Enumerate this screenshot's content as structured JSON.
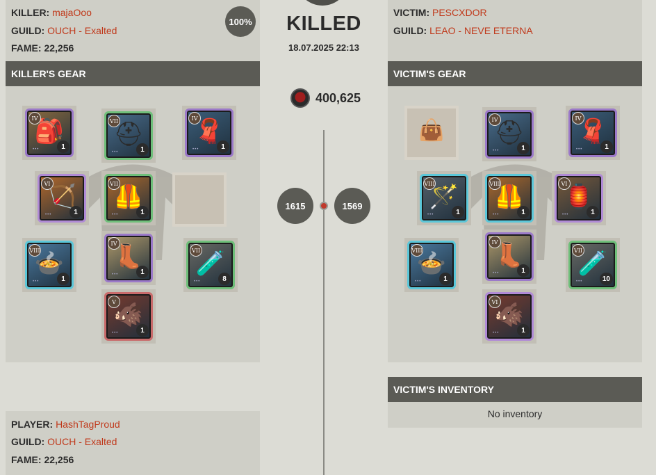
{
  "killer": {
    "killer_label": "KILLER:",
    "name": "majaOoo",
    "guild_label": "GUILD:",
    "guild": "OUCH - Exalted",
    "fame_label": "FAME:",
    "fame": "22,256",
    "damage_pct": "100%"
  },
  "event": {
    "title": "KILLED",
    "datetime": "18.07.2025 22:13",
    "total_fame": "400,625",
    "killer_ip": "1615",
    "victim_ip": "1569"
  },
  "victim": {
    "victim_label": "VICTIM:",
    "name": "PESCXDOR",
    "guild_label": "GUILD:",
    "guild": "LEAO - NEVE ETERNA"
  },
  "headers": {
    "killer_gear": "KILLER'S GEAR",
    "victim_gear": "VICTIM'S GEAR",
    "victim_inventory": "VICTIM'S INVENTORY",
    "no_inventory": "No inventory"
  },
  "assist": {
    "player_label": "PLAYER:",
    "name": "HashTagProud",
    "guild_label": "GUILD:",
    "guild": "OUCH - Exalted",
    "fame_label": "FAME:",
    "fame": "22,256"
  },
  "killer_gear": [
    {
      "slot": "bag",
      "tier": "IV",
      "qty": "1",
      "icon": "bag-icon"
    },
    {
      "slot": "head",
      "tier": "VII",
      "qty": "1",
      "icon": "helmet-icon"
    },
    {
      "slot": "cape",
      "tier": "IV",
      "qty": "1",
      "icon": "cape-icon"
    },
    {
      "slot": "mainhand",
      "tier": "VI",
      "qty": "1",
      "icon": "crossbow-icon"
    },
    {
      "slot": "armor",
      "tier": "VII",
      "qty": "1",
      "icon": "armor-icon"
    },
    {
      "slot": "food",
      "tier": "VIII",
      "qty": "1",
      "icon": "stew-icon"
    },
    {
      "slot": "shoes",
      "tier": "IV",
      "qty": "1",
      "icon": "boots-icon"
    },
    {
      "slot": "potion",
      "tier": "VII",
      "qty": "8",
      "icon": "potion-icon"
    },
    {
      "slot": "mount",
      "tier": "V",
      "qty": "1",
      "icon": "mount-icon"
    }
  ],
  "victim_gear": [
    {
      "slot": "head",
      "tier": "IV",
      "qty": "1",
      "icon": "helmet-icon"
    },
    {
      "slot": "cape",
      "tier": "IV",
      "qty": "1",
      "icon": "cape-icon"
    },
    {
      "slot": "mainhand",
      "tier": "VIII",
      "qty": "1",
      "icon": "staff-icon"
    },
    {
      "slot": "armor",
      "tier": "VIII",
      "qty": "1",
      "icon": "armor-icon"
    },
    {
      "slot": "offhand",
      "tier": "VI",
      "qty": "1",
      "icon": "offhand-icon"
    },
    {
      "slot": "food",
      "tier": "VIII",
      "qty": "1",
      "icon": "stew-icon"
    },
    {
      "slot": "shoes",
      "tier": "IV",
      "qty": "1",
      "icon": "boots-icon"
    },
    {
      "slot": "potion",
      "tier": "VII",
      "qty": "10",
      "icon": "potion-icon"
    },
    {
      "slot": "mount",
      "tier": "VI",
      "qty": "1",
      "icon": "mount-icon"
    }
  ],
  "colors": {
    "accent_text": "#c0391b",
    "header_bg": "#5b5b55",
    "panel_bg": "#cfcfc7",
    "page_bg": "#dcdcd5"
  }
}
